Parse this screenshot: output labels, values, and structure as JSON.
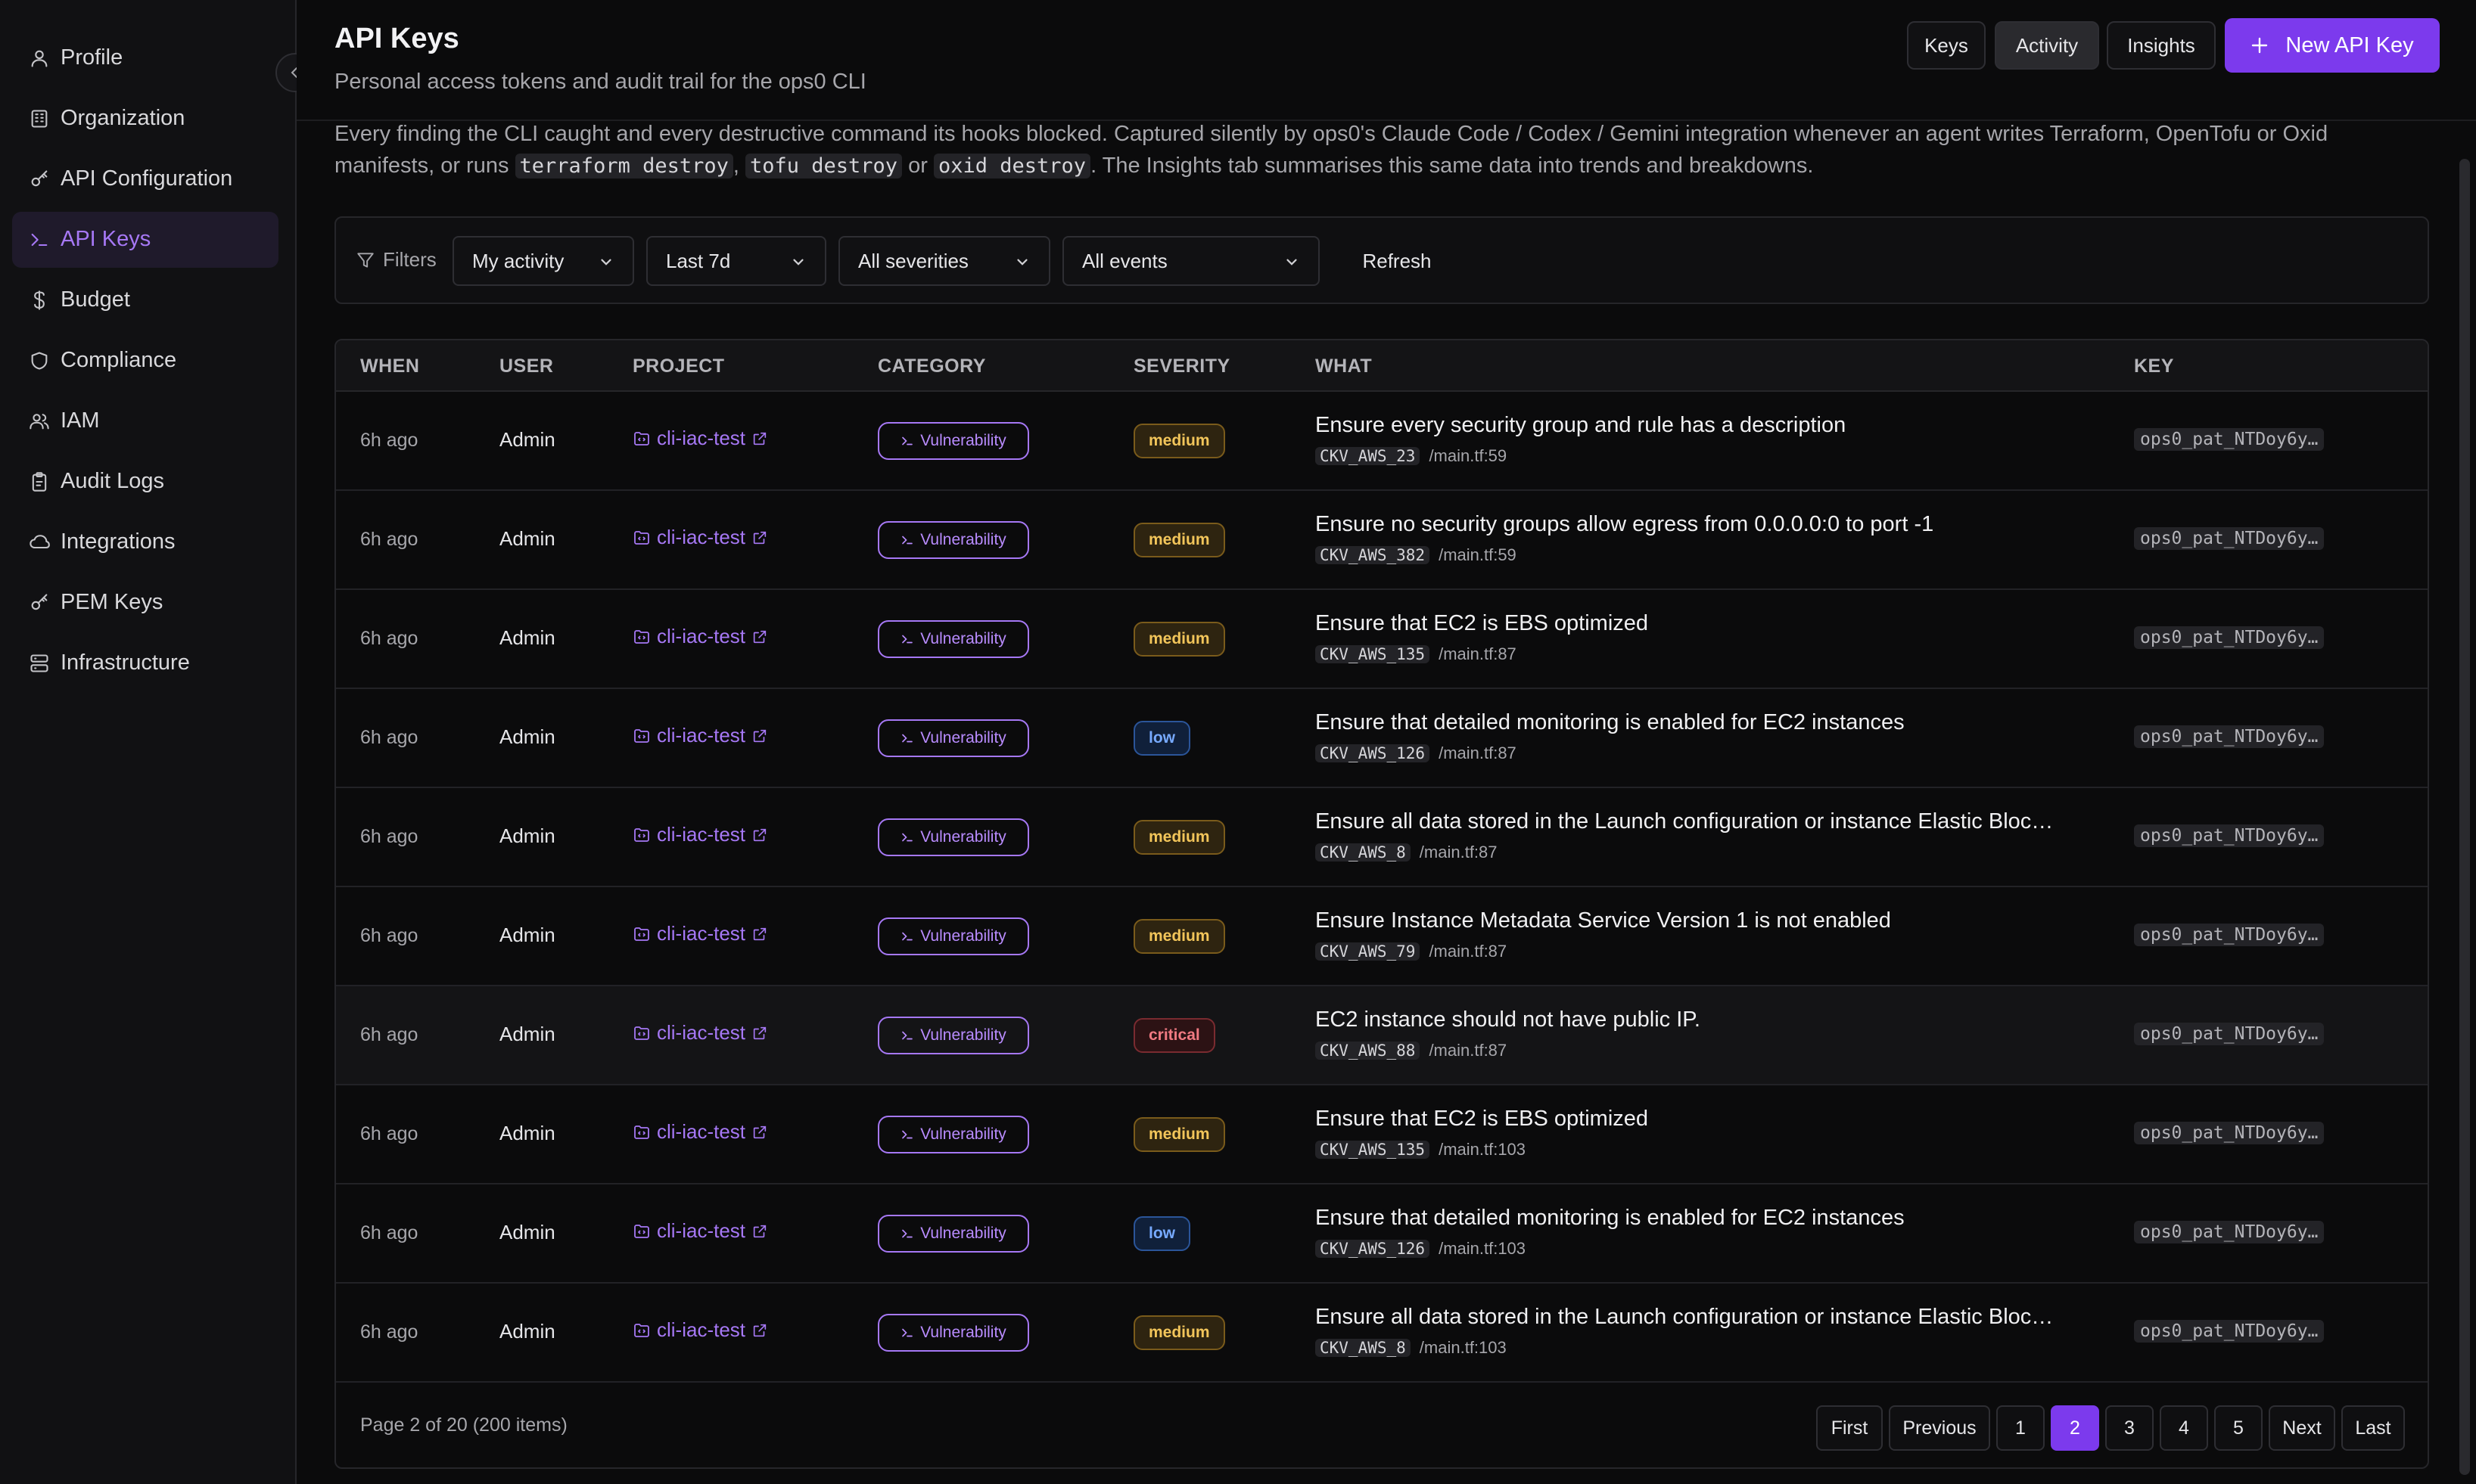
{
  "sidebar": {
    "items": [
      {
        "label": "Profile",
        "icon": "user-icon"
      },
      {
        "label": "Organization",
        "icon": "building-icon"
      },
      {
        "label": "API Configuration",
        "icon": "key-icon"
      },
      {
        "label": "API Keys",
        "icon": "terminal-icon"
      },
      {
        "label": "Budget",
        "icon": "dollar-icon"
      },
      {
        "label": "Compliance",
        "icon": "shield-icon"
      },
      {
        "label": "IAM",
        "icon": "users-icon"
      },
      {
        "label": "Audit Logs",
        "icon": "clipboard-icon"
      },
      {
        "label": "Integrations",
        "icon": "cloud-icon"
      },
      {
        "label": "PEM Keys",
        "icon": "key-icon"
      },
      {
        "label": "Infrastructure",
        "icon": "server-icon"
      }
    ],
    "active_index": 3
  },
  "header": {
    "title": "API Keys",
    "subtitle": "Personal access tokens and audit trail for the ops0 CLI",
    "tabs": [
      "Keys",
      "Activity",
      "Insights"
    ],
    "active_tab": "Activity",
    "new_key_label": "New API Key"
  },
  "description": {
    "text1": "Every finding the CLI caught and every destructive command its hooks blocked. Captured silently by ops0's Claude Code / Codex / Gemini integration whenever an agent writes Terraform, OpenTofu or Oxid manifests, or runs ",
    "code1": "terraform destroy",
    "sep1": ", ",
    "code2": "tofu destroy",
    "sep2": " or ",
    "code3": "oxid destroy",
    "text2": ". The Insights tab summarises this same data into trends and breakdowns."
  },
  "filters": {
    "label": "Filters",
    "scope": "My activity",
    "range": "Last 7d",
    "severity": "All severities",
    "events": "All events",
    "refresh": "Refresh"
  },
  "table": {
    "columns": [
      "WHEN",
      "USER",
      "PROJECT",
      "CATEGORY",
      "SEVERITY",
      "WHAT",
      "KEY"
    ],
    "rows": [
      {
        "when": "6h ago",
        "user": "Admin",
        "project": "cli-iac-test",
        "category": "Vulnerability",
        "severity": "medium",
        "what": "Ensure every security group and rule has a description",
        "check": "CKV_AWS_23",
        "file": "/main.tf:59",
        "key": "ops0_pat_NTDoy6y…"
      },
      {
        "when": "6h ago",
        "user": "Admin",
        "project": "cli-iac-test",
        "category": "Vulnerability",
        "severity": "medium",
        "what": "Ensure no security groups allow egress from 0.0.0.0:0 to port -1",
        "check": "CKV_AWS_382",
        "file": "/main.tf:59",
        "key": "ops0_pat_NTDoy6y…"
      },
      {
        "when": "6h ago",
        "user": "Admin",
        "project": "cli-iac-test",
        "category": "Vulnerability",
        "severity": "medium",
        "what": "Ensure that EC2 is EBS optimized",
        "check": "CKV_AWS_135",
        "file": "/main.tf:87",
        "key": "ops0_pat_NTDoy6y…"
      },
      {
        "when": "6h ago",
        "user": "Admin",
        "project": "cli-iac-test",
        "category": "Vulnerability",
        "severity": "low",
        "what": "Ensure that detailed monitoring is enabled for EC2 instances",
        "check": "CKV_AWS_126",
        "file": "/main.tf:87",
        "key": "ops0_pat_NTDoy6y…"
      },
      {
        "when": "6h ago",
        "user": "Admin",
        "project": "cli-iac-test",
        "category": "Vulnerability",
        "severity": "medium",
        "what": "Ensure all data stored in the Launch configuration or instance Elastic Bloc…",
        "check": "CKV_AWS_8",
        "file": "/main.tf:87",
        "key": "ops0_pat_NTDoy6y…"
      },
      {
        "when": "6h ago",
        "user": "Admin",
        "project": "cli-iac-test",
        "category": "Vulnerability",
        "severity": "medium",
        "what": "Ensure Instance Metadata Service Version 1 is not enabled",
        "check": "CKV_AWS_79",
        "file": "/main.tf:87",
        "key": "ops0_pat_NTDoy6y…"
      },
      {
        "when": "6h ago",
        "user": "Admin",
        "project": "cli-iac-test",
        "category": "Vulnerability",
        "severity": "critical",
        "what": "EC2 instance should not have public IP.",
        "check": "CKV_AWS_88",
        "file": "/main.tf:87",
        "key": "ops0_pat_NTDoy6y…"
      },
      {
        "when": "6h ago",
        "user": "Admin",
        "project": "cli-iac-test",
        "category": "Vulnerability",
        "severity": "medium",
        "what": "Ensure that EC2 is EBS optimized",
        "check": "CKV_AWS_135",
        "file": "/main.tf:103",
        "key": "ops0_pat_NTDoy6y…"
      },
      {
        "when": "6h ago",
        "user": "Admin",
        "project": "cli-iac-test",
        "category": "Vulnerability",
        "severity": "low",
        "what": "Ensure that detailed monitoring is enabled for EC2 instances",
        "check": "CKV_AWS_126",
        "file": "/main.tf:103",
        "key": "ops0_pat_NTDoy6y…"
      },
      {
        "when": "6h ago",
        "user": "Admin",
        "project": "cli-iac-test",
        "category": "Vulnerability",
        "severity": "medium",
        "what": "Ensure all data stored in the Launch configuration or instance Elastic Bloc…",
        "check": "CKV_AWS_8",
        "file": "/main.tf:103",
        "key": "ops0_pat_NTDoy6y…"
      }
    ]
  },
  "pagination": {
    "info": "Page 2 of 20 (200 items)",
    "first": "First",
    "previous": "Previous",
    "pages": [
      "1",
      "2",
      "3",
      "4",
      "5"
    ],
    "current": "2",
    "next": "Next",
    "last": "Last"
  },
  "colors": {
    "accent": "#7c3aed",
    "accent_text": "#a678f5",
    "background": "#0b0b0c",
    "medium": "#f2c55a",
    "low": "#77aaff",
    "critical": "#f07a82"
  }
}
